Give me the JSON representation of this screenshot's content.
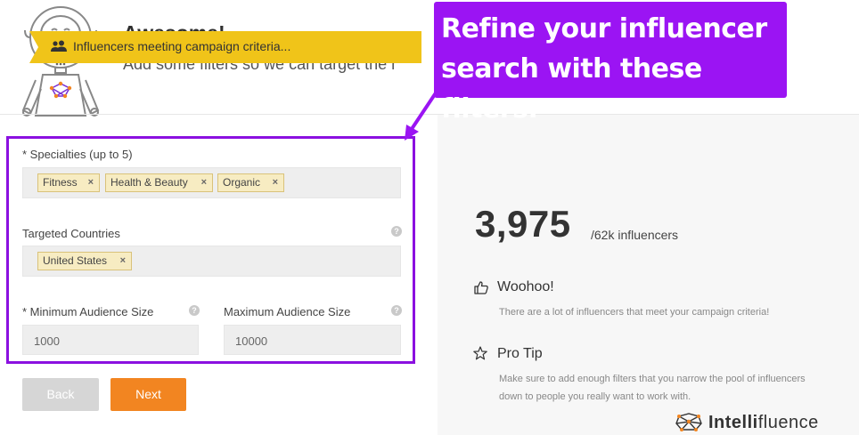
{
  "header": {
    "title": "Awesome!",
    "subtitle": "Add some filters so we can target the r"
  },
  "callout": {
    "text": "Refine your influencer\nsearch with these filters."
  },
  "form": {
    "specialties": {
      "label": "* Specialties (up to 5)",
      "tags": [
        {
          "label": "Fitness",
          "remove": "×"
        },
        {
          "label": "Health & Beauty",
          "remove": "×"
        },
        {
          "label": "Organic",
          "remove": "×"
        }
      ]
    },
    "countries": {
      "label": "Targeted Countries",
      "help": "?",
      "tags": [
        {
          "label": "United States",
          "remove": "×"
        }
      ]
    },
    "min_audience": {
      "label": "* Minimum Audience Size",
      "help": "?",
      "value": "1000"
    },
    "max_audience": {
      "label": "Maximum Audience Size",
      "help": "?",
      "value": "10000"
    }
  },
  "buttons": {
    "back": "Back",
    "next": "Next"
  },
  "summary": {
    "banner": "Influencers meeting campaign criteria...",
    "banner_icon": "users-icon",
    "count": "3,975",
    "count_suffix": "/62k influencers",
    "woohoo": {
      "icon": "thumbs-up-icon",
      "title": "Woohoo!",
      "text": "There are a lot of influencers that meet your campaign criteria!"
    },
    "protip": {
      "icon": "star-icon",
      "title": "Pro Tip",
      "text_line1": "Make sure to add enough filters that you narrow the pool of influencers",
      "text_line2": "down to people you really want to work with."
    }
  },
  "brand": {
    "bold": "Intelli",
    "light": "fluence"
  },
  "colors": {
    "callout": "#9b14f3",
    "panel_border": "#8b10e0",
    "banner": "#f0c419",
    "next_button": "#f28521",
    "back_button": "#d6d6d6",
    "tag_bg": "#f7ecc2"
  }
}
